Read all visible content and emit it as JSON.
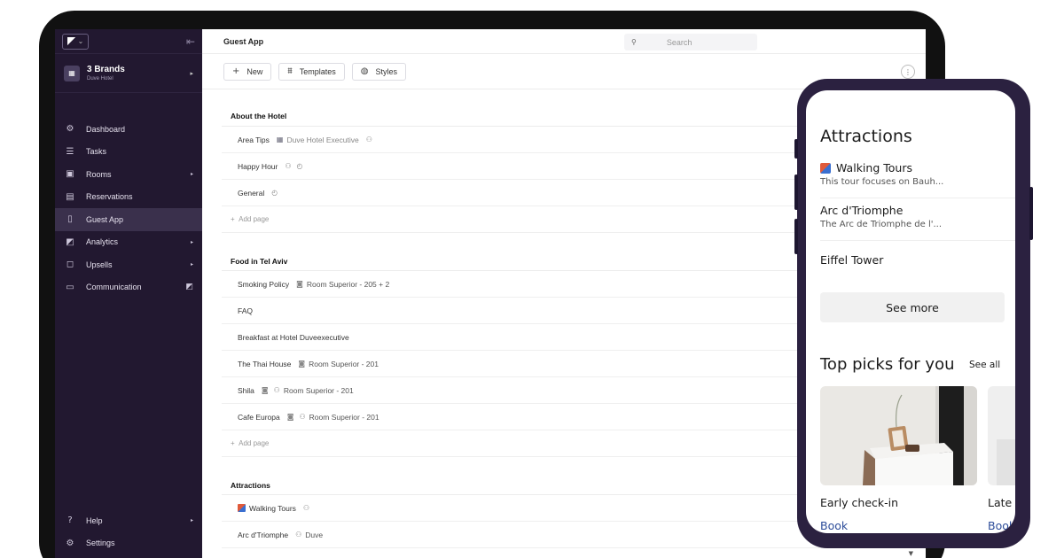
{
  "sidebar": {
    "logo_icon": "duve-logo-icon",
    "brand": {
      "name": "3 Brands",
      "sub": "Duve Hotel"
    },
    "items": [
      {
        "label": "Dashboard",
        "icon": "dashboard-icon",
        "glyph": "⚙",
        "arrow": ""
      },
      {
        "label": "Tasks",
        "icon": "tasks-icon",
        "glyph": "☰",
        "arrow": ""
      },
      {
        "label": "Rooms",
        "icon": "rooms-icon",
        "glyph": "▣",
        "arrow": "▸"
      },
      {
        "label": "Reservations",
        "icon": "reservations-icon",
        "glyph": "▤",
        "arrow": ""
      },
      {
        "label": "Guest App",
        "icon": "guest-app-icon",
        "glyph": "▯",
        "arrow": ""
      },
      {
        "label": "Analytics",
        "icon": "analytics-icon",
        "glyph": "◩",
        "arrow": "▸"
      },
      {
        "label": "Upsells",
        "icon": "upsells-icon",
        "glyph": "◻",
        "arrow": "▸"
      },
      {
        "label": "Communication",
        "icon": "communication-icon",
        "glyph": "▭",
        "arrow": "◩"
      }
    ],
    "bottom": [
      {
        "label": "Help",
        "icon": "help-icon",
        "glyph": "?",
        "arrow": "▸"
      },
      {
        "label": "Settings",
        "icon": "settings-icon",
        "glyph": "⚙",
        "arrow": ""
      }
    ]
  },
  "topbar": {
    "title": "Guest App",
    "search_placeholder": "Search"
  },
  "toolbar": {
    "new_label": "New",
    "templates_label": "Templates",
    "styles_label": "Styles"
  },
  "sections": [
    {
      "title": "About the Hotel",
      "rows": [
        {
          "title": "Area Tips",
          "meta": "Duve Hotel Executive"
        },
        {
          "title": "Happy Hour"
        },
        {
          "title": "General"
        }
      ],
      "add_label": "Add page"
    },
    {
      "title": "Food in Tel Aviv",
      "rows": [
        {
          "title": "Smoking Policy",
          "meta": "Room Superior - 205 + 2"
        },
        {
          "title": "FAQ"
        },
        {
          "title": "Breakfast at Hotel Duveexecutive"
        },
        {
          "title": "The Thai House",
          "meta": "Room Superior - 201"
        },
        {
          "title": "Shila",
          "meta": "Room Superior - 201"
        },
        {
          "title": "Cafe Europa",
          "meta": "Room Superior - 201"
        }
      ],
      "add_label": "Add page"
    },
    {
      "title": "Attractions",
      "rows": [
        {
          "title": "Walking Tours"
        },
        {
          "title": "Arc d'Triomphe",
          "meta": "Duve"
        }
      ]
    }
  ],
  "phone": {
    "title": "Attractions",
    "items": [
      {
        "title": "Walking Tours",
        "sub": "This tour focuses on Bauh..."
      },
      {
        "title": "Arc d'Triomphe",
        "sub": "The Arc de Triomphe de l'..."
      },
      {
        "title": "Eiffel Tower",
        "sub": ""
      }
    ],
    "see_more": "See more",
    "picks_title": "Top picks for you",
    "see_all": "See all",
    "cards": [
      {
        "title": "Early check-in",
        "action": "Book"
      },
      {
        "title": "Late",
        "action": "Book"
      }
    ]
  }
}
